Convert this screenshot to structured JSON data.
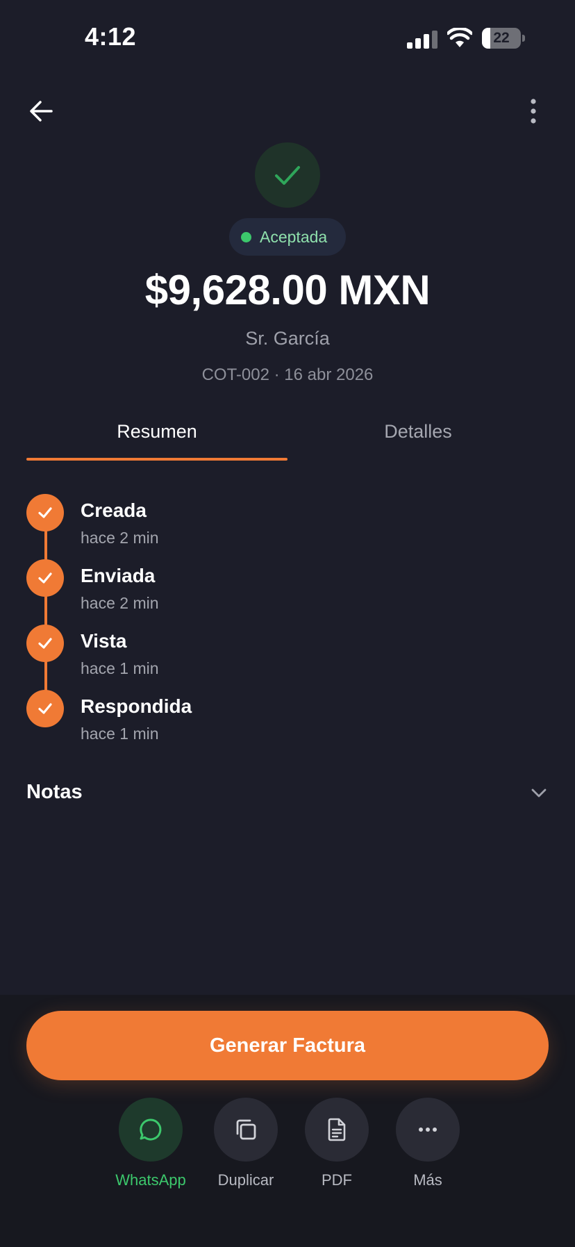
{
  "status_bar": {
    "time": "4:12",
    "battery_percent": "22"
  },
  "header": {
    "back_icon": "arrow-left-icon",
    "more_icon": "more-vertical-icon"
  },
  "quote": {
    "status_icon": "check-icon",
    "status_label": "Aceptada",
    "status_color": "#3cc86c",
    "amount": "$9,628.00 MXN",
    "client": "Sr. García",
    "meta": "COT-002 · 16 abr 2026"
  },
  "tabs": [
    {
      "label": "Resumen",
      "active": true
    },
    {
      "label": "Detalles",
      "active": false
    }
  ],
  "timeline": [
    {
      "title": "Creada",
      "time": "hace 2 min"
    },
    {
      "title": "Enviada",
      "time": "hace 2 min"
    },
    {
      "title": "Vista",
      "time": "hace 1 min"
    },
    {
      "title": "Respondida",
      "time": "hace 1 min"
    }
  ],
  "notes": {
    "label": "Notas",
    "icon": "chevron-down-icon"
  },
  "primary_action": {
    "label": "Generar Factura",
    "color": "#f07a35"
  },
  "actions": [
    {
      "label": "WhatsApp",
      "icon": "whatsapp-icon"
    },
    {
      "label": "Duplicar",
      "icon": "duplicate-icon"
    },
    {
      "label": "PDF",
      "icon": "pdf-icon"
    },
    {
      "label": "Más",
      "icon": "more-horizontal-icon"
    }
  ]
}
